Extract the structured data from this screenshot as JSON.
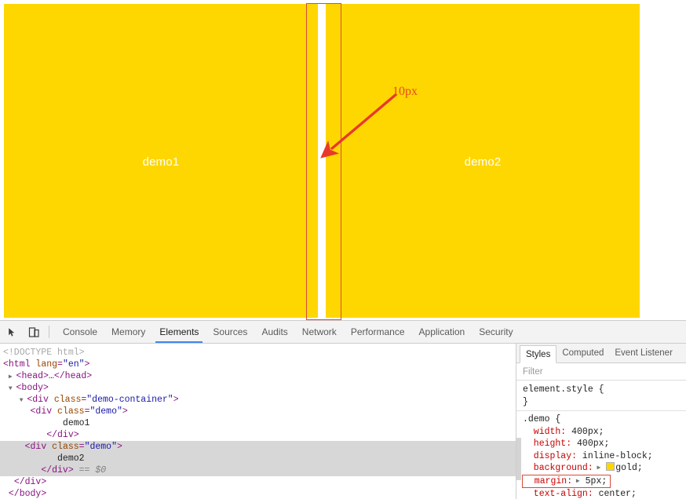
{
  "page": {
    "boxes": [
      {
        "label": "demo1"
      },
      {
        "label": "demo2"
      }
    ],
    "annotation": {
      "gap_label": "10px",
      "highlight_color": "#d94a3a",
      "arrow_color": "#e8392b"
    },
    "box_color": "#ffd700",
    "label_color": "#ffffff"
  },
  "devtools": {
    "toolbar": {
      "inspect_icon": "inspect-cursor-icon",
      "device_toolbar_icon": "device-toolbar-icon",
      "tabs": [
        {
          "label": "Console",
          "active": false
        },
        {
          "label": "Memory",
          "active": false
        },
        {
          "label": "Elements",
          "active": true
        },
        {
          "label": "Sources",
          "active": false
        },
        {
          "label": "Audits",
          "active": false
        },
        {
          "label": "Network",
          "active": false
        },
        {
          "label": "Performance",
          "active": false
        },
        {
          "label": "Application",
          "active": false
        },
        {
          "label": "Security",
          "active": false
        }
      ]
    },
    "dom_tree": {
      "lines": [
        {
          "indent": 0,
          "twisty": "",
          "selected": false,
          "parts": [
            {
              "t": "doctype",
              "s": "<!DOCTYPE html>"
            }
          ]
        },
        {
          "indent": 0,
          "twisty": "",
          "selected": false,
          "parts": [
            {
              "t": "punct",
              "s": "<"
            },
            {
              "t": "tag",
              "s": "html"
            },
            {
              "t": "sp",
              "s": " "
            },
            {
              "t": "attr",
              "s": "lang"
            },
            {
              "t": "punct",
              "s": "="
            },
            {
              "t": "val",
              "s": "\"en\""
            },
            {
              "t": "punct",
              "s": ">"
            }
          ]
        },
        {
          "indent": 1,
          "twisty": "▶",
          "selected": false,
          "parts": [
            {
              "t": "punct",
              "s": "<"
            },
            {
              "t": "tag",
              "s": "head"
            },
            {
              "t": "punct",
              "s": ">"
            },
            {
              "t": "text",
              "s": "…"
            },
            {
              "t": "punct",
              "s": "</"
            },
            {
              "t": "tag",
              "s": "head"
            },
            {
              "t": "punct",
              "s": ">"
            }
          ]
        },
        {
          "indent": 1,
          "twisty": "▼",
          "selected": false,
          "parts": [
            {
              "t": "punct",
              "s": "<"
            },
            {
              "t": "tag",
              "s": "body"
            },
            {
              "t": "punct",
              "s": ">"
            }
          ]
        },
        {
          "indent": 3,
          "twisty": "▼",
          "selected": false,
          "parts": [
            {
              "t": "punct",
              "s": "<"
            },
            {
              "t": "tag",
              "s": "div"
            },
            {
              "t": "sp",
              "s": " "
            },
            {
              "t": "attr",
              "s": "class"
            },
            {
              "t": "punct",
              "s": "="
            },
            {
              "t": "val",
              "s": "\"demo-container\""
            },
            {
              "t": "punct",
              "s": ">"
            }
          ]
        },
        {
          "indent": 5,
          "twisty": "",
          "selected": false,
          "parts": [
            {
              "t": "punct",
              "s": "<"
            },
            {
              "t": "tag",
              "s": "div"
            },
            {
              "t": "sp",
              "s": " "
            },
            {
              "t": "attr",
              "s": "class"
            },
            {
              "t": "punct",
              "s": "="
            },
            {
              "t": "val",
              "s": "\"demo\""
            },
            {
              "t": "punct",
              "s": ">"
            }
          ]
        },
        {
          "indent": 11,
          "twisty": "",
          "selected": false,
          "parts": [
            {
              "t": "text",
              "s": "demo1"
            }
          ]
        },
        {
          "indent": 8,
          "twisty": "",
          "selected": false,
          "parts": [
            {
              "t": "punct",
              "s": "</"
            },
            {
              "t": "tag",
              "s": "div"
            },
            {
              "t": "punct",
              "s": ">"
            }
          ]
        },
        {
          "indent": 4,
          "twisty": "",
          "selected": true,
          "parts": [
            {
              "t": "punct",
              "s": "<"
            },
            {
              "t": "tag",
              "s": "div"
            },
            {
              "t": "sp",
              "s": " "
            },
            {
              "t": "attr",
              "s": "class"
            },
            {
              "t": "punct",
              "s": "="
            },
            {
              "t": "val",
              "s": "\"demo\""
            },
            {
              "t": "punct",
              "s": ">"
            }
          ]
        },
        {
          "indent": 10,
          "twisty": "",
          "selected": true,
          "parts": [
            {
              "t": "text",
              "s": "demo2"
            }
          ]
        },
        {
          "indent": 7,
          "twisty": "",
          "selected": true,
          "parts": [
            {
              "t": "punct",
              "s": "</"
            },
            {
              "t": "tag",
              "s": "div"
            },
            {
              "t": "punct",
              "s": ">"
            },
            {
              "t": "dollar",
              "s": " == $0"
            }
          ]
        },
        {
          "indent": 2,
          "twisty": "",
          "selected": false,
          "parts": [
            {
              "t": "punct",
              "s": "</"
            },
            {
              "t": "tag",
              "s": "div"
            },
            {
              "t": "punct",
              "s": ">"
            }
          ]
        },
        {
          "indent": 1,
          "twisty": "",
          "selected": false,
          "parts": [
            {
              "t": "punct",
              "s": "</"
            },
            {
              "t": "tag",
              "s": "body"
            },
            {
              "t": "punct",
              "s": ">"
            }
          ]
        }
      ]
    },
    "styles": {
      "tabs": [
        {
          "label": "Styles",
          "active": true
        },
        {
          "label": "Computed",
          "active": false
        },
        {
          "label": "Event Listener",
          "active": false
        }
      ],
      "filter_placeholder": "Filter",
      "rules": [
        {
          "selector": "element.style {",
          "close": "}",
          "props": []
        },
        {
          "selector": ".demo {",
          "close": "",
          "props": [
            {
              "name": "width",
              "value": "400px;",
              "highlighted": false,
              "expander": false,
              "swatch": false
            },
            {
              "name": "height",
              "value": "400px;",
              "highlighted": false,
              "expander": false,
              "swatch": false
            },
            {
              "name": "display",
              "value": "inline-block;",
              "highlighted": false,
              "expander": false,
              "swatch": false
            },
            {
              "name": "background",
              "value": "gold;",
              "highlighted": false,
              "expander": true,
              "swatch": true
            },
            {
              "name": "margin",
              "value": "5px;",
              "highlighted": true,
              "expander": true,
              "swatch": false
            },
            {
              "name": "text-align",
              "value": "center;",
              "highlighted": false,
              "expander": false,
              "swatch": false
            }
          ]
        }
      ]
    }
  }
}
